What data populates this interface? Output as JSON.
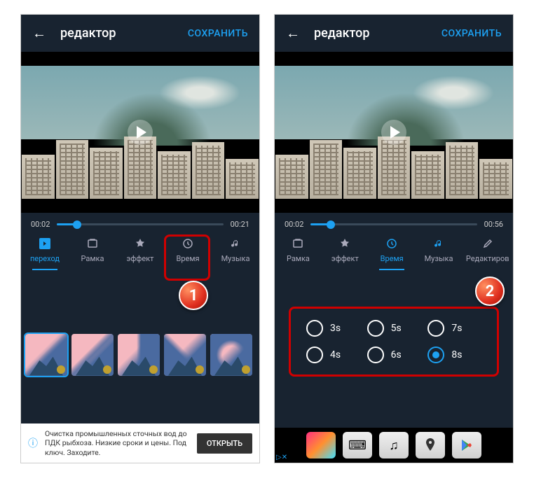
{
  "header": {
    "title": "редактор",
    "save": "СОХРАНИТЬ"
  },
  "left": {
    "time_start": "00:02",
    "time_end": "00:21",
    "tabs": [
      {
        "id": "transition",
        "label": "переход",
        "active": true
      },
      {
        "id": "frame",
        "label": "Рамка"
      },
      {
        "id": "effect",
        "label": "эффект"
      },
      {
        "id": "time",
        "label": "Время",
        "highlighted": true
      },
      {
        "id": "music",
        "label": "Музыка"
      }
    ],
    "step_badge": "1",
    "ad": {
      "text": "Очистка промышленных сточных вод до ПДК рыбхоза. Низкие сроки и цены. Под ключ. Заходите.",
      "cta": "ОТКРЫТЬ"
    }
  },
  "right": {
    "time_start": "00:02",
    "time_end": "00:56",
    "tabs": [
      {
        "id": "frame",
        "label": "Рамка"
      },
      {
        "id": "effect",
        "label": "эффект"
      },
      {
        "id": "time",
        "label": "Время",
        "active": true
      },
      {
        "id": "music",
        "label": "Музыка"
      },
      {
        "id": "edit",
        "label": "Редактиров"
      }
    ],
    "step_badge": "2",
    "time_options": [
      {
        "label": "3s"
      },
      {
        "label": "5s"
      },
      {
        "label": "7s"
      },
      {
        "label": "4s"
      },
      {
        "label": "6s"
      },
      {
        "label": "8s",
        "checked": true
      }
    ],
    "ad_marker": "▷✕"
  }
}
